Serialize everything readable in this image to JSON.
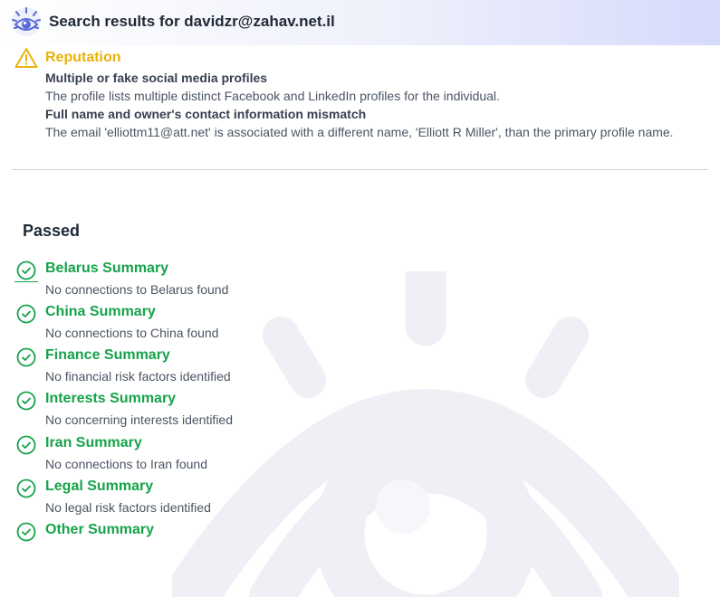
{
  "header": {
    "title": "Search results for davidzr@zahav.net.il",
    "logo_icon": "eye-logo-icon"
  },
  "warning": {
    "icon": "warning-triangle-icon",
    "category": "Reputation",
    "findings": [
      {
        "title": "Multiple or fake social media profiles",
        "description": "The profile lists multiple distinct Facebook and LinkedIn profiles for the individual."
      },
      {
        "title": "Full name and owner's contact information mismatch",
        "description": "The email 'elliottm11@att.net' is associated with a different name, 'Elliott R Miller', than the primary profile name."
      }
    ]
  },
  "passed": {
    "title": "Passed",
    "icon": "check-circle-icon",
    "items": [
      {
        "title": "Belarus Summary",
        "description": "No connections to Belarus found"
      },
      {
        "title": "China Summary",
        "description": "No connections to China found"
      },
      {
        "title": "Finance Summary",
        "description": "No financial risk factors identified"
      },
      {
        "title": "Interests Summary",
        "description": "No concerning interests identified"
      },
      {
        "title": "Iran Summary",
        "description": "No connections to Iran found"
      },
      {
        "title": "Legal Summary",
        "description": "No legal risk factors identified"
      },
      {
        "title": "Other Summary",
        "description": ""
      }
    ]
  },
  "colors": {
    "warning": "#eab308",
    "pass": "#16a34a",
    "brand": "#5b6bd6"
  }
}
